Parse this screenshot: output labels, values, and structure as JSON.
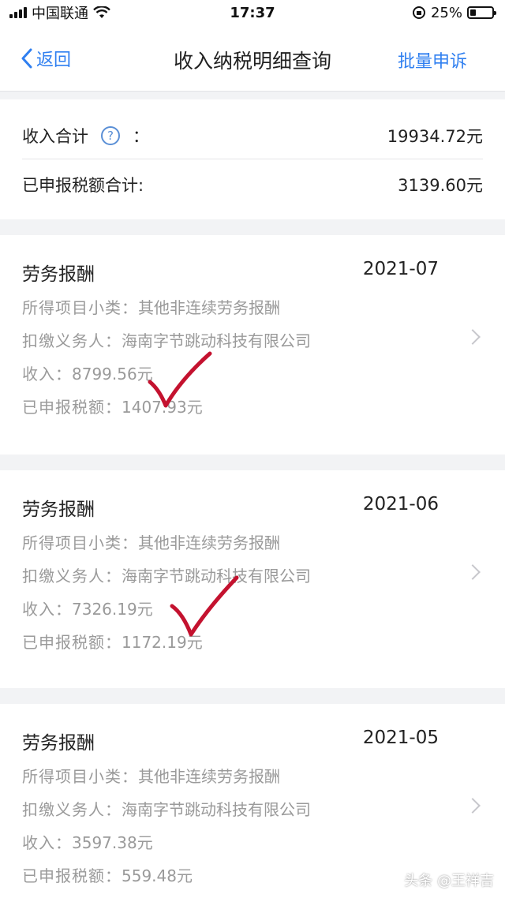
{
  "status_bar": {
    "carrier": "中国联通",
    "time": "17:37",
    "battery": "25%",
    "battery_level": 0.25
  },
  "nav": {
    "back_label": "返回",
    "title": "收入纳税明细查询",
    "action_label": "批量申诉"
  },
  "summary": {
    "income_label": "收入合计",
    "income_colon": "：",
    "income_value": "19934.72元",
    "tax_label": "已申报税额合计:",
    "tax_value": "3139.60元"
  },
  "records": [
    {
      "type": "劳务报酬",
      "date": "2021-07",
      "subcategory_label": "所得项目小类：",
      "subcategory": "其他非连续劳务报酬",
      "withholder_label": "扣缴义务人：",
      "withholder": "海南字节跳动科技有限公司",
      "income_label": "收入：",
      "income": "8799.56元",
      "tax_label": "已申报税额：",
      "tax": "1407.93元"
    },
    {
      "type": "劳务报酬",
      "date": "2021-06",
      "subcategory_label": "所得项目小类：",
      "subcategory": "其他非连续劳务报酬",
      "withholder_label": "扣缴义务人：",
      "withholder": "海南字节跳动科技有限公司",
      "income_label": "收入：",
      "income": "7326.19元",
      "tax_label": "已申报税额：",
      "tax": "1172.19元"
    },
    {
      "type": "劳务报酬",
      "date": "2021-05",
      "subcategory_label": "所得项目小类：",
      "subcategory": "其他非连续劳务报酬",
      "withholder_label": "扣缴义务人：",
      "withholder": "海南字节跳动科技有限公司",
      "income_label": "收入：",
      "income": "3597.38元",
      "tax_label": "已申报税额：",
      "tax": "559.48元"
    }
  ],
  "watermark": "头条 @王祥吉",
  "colors": {
    "accent": "#2f7ff0",
    "check_mark": "#c4122f"
  }
}
